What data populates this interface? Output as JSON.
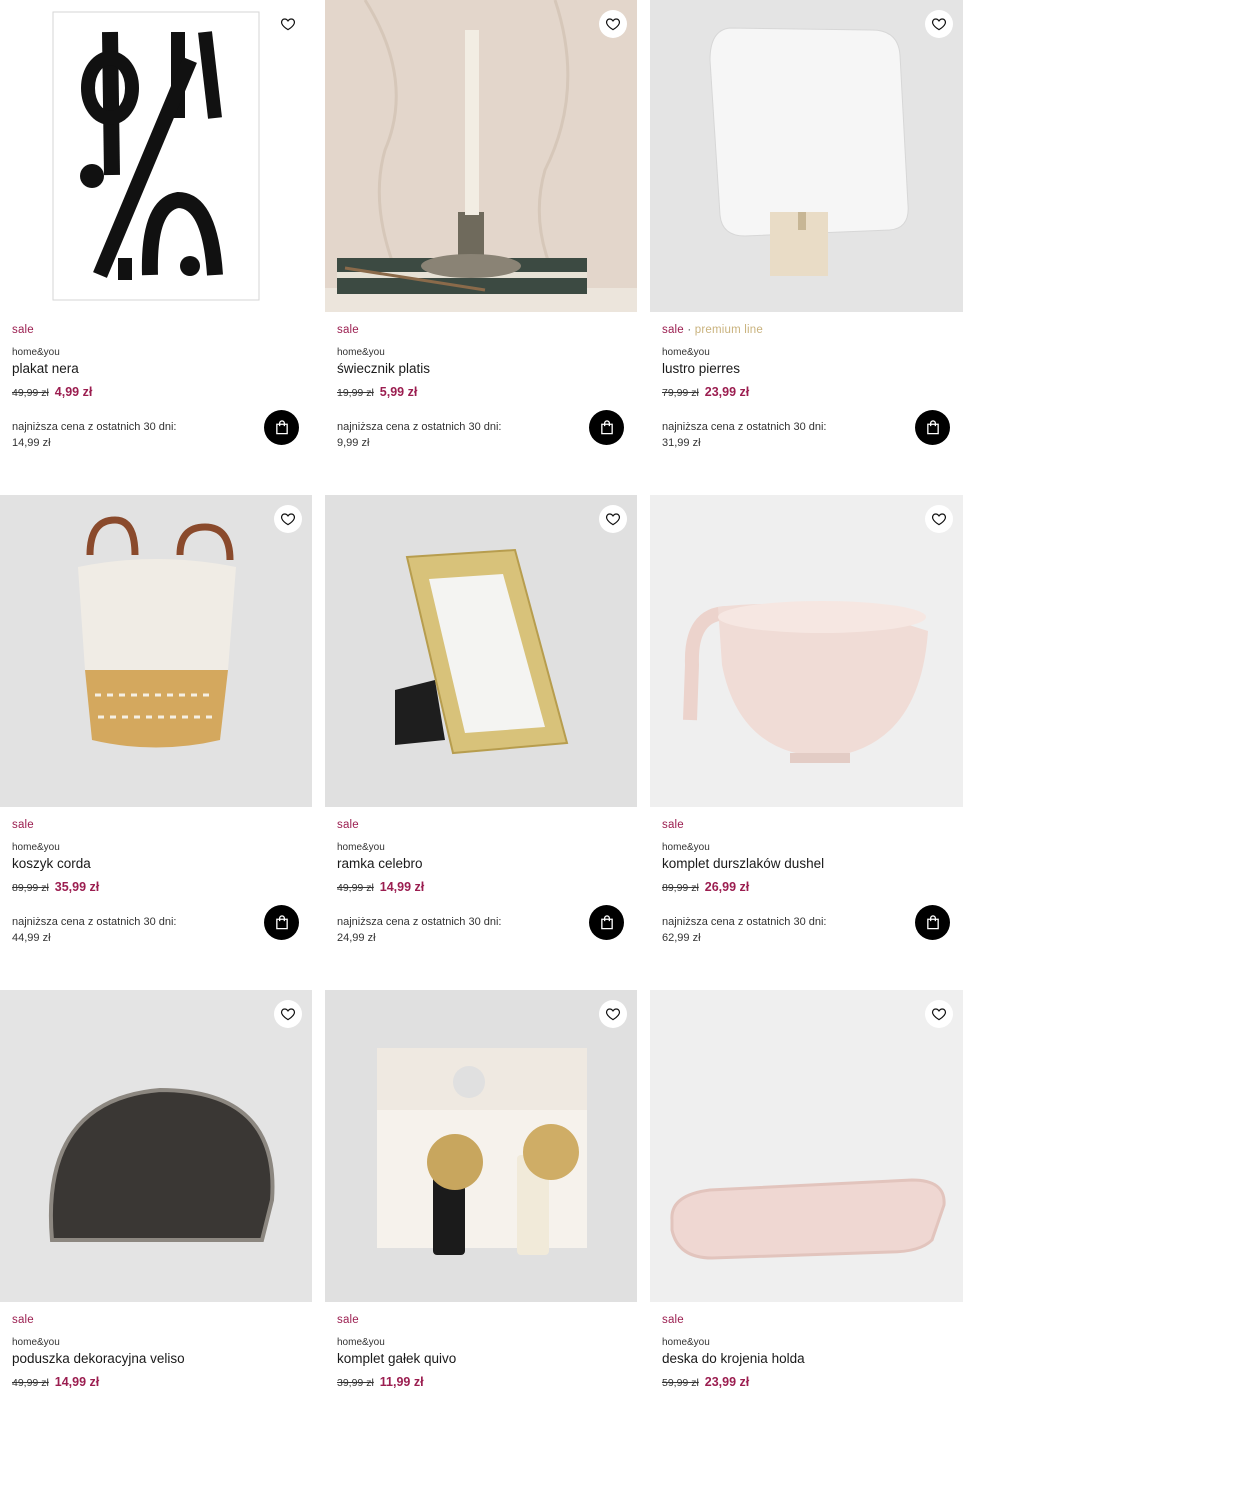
{
  "labels": {
    "sale": "sale",
    "dot": "·",
    "premium": "premium line",
    "lowest_price": "najniższa cena z ostatnich 30 dni:",
    "brand": "home&you"
  },
  "colors": {
    "sale": "#9b1e50",
    "premium": "#c9b27d"
  },
  "products": [
    {
      "name": "plakat nera",
      "old_price": "49,99 zł",
      "new_price": "4,99 zł",
      "lowest": "14,99 zł",
      "premium": false
    },
    {
      "name": "świecznik platis",
      "old_price": "19,99 zł",
      "new_price": "5,99 zł",
      "lowest": "9,99 zł",
      "premium": false
    },
    {
      "name": "lustro pierres",
      "old_price": "79,99 zł",
      "new_price": "23,99 zł",
      "lowest": "31,99 zł",
      "premium": true
    },
    {
      "name": "koszyk corda",
      "old_price": "89,99 zł",
      "new_price": "35,99 zł",
      "lowest": "44,99 zł",
      "premium": false
    },
    {
      "name": "ramka celebro",
      "old_price": "49,99 zł",
      "new_price": "14,99 zł",
      "lowest": "24,99 zł",
      "premium": false
    },
    {
      "name": "komplet durszlaków dushel",
      "old_price": "89,99 zł",
      "new_price": "26,99 zł",
      "lowest": "62,99 zł",
      "premium": false
    },
    {
      "name": "poduszka dekoracyjna veliso",
      "old_price": "49,99 zł",
      "new_price": "14,99 zł",
      "lowest": "",
      "premium": false
    },
    {
      "name": "komplet gałek quivo",
      "old_price": "39,99 zł",
      "new_price": "11,99 zł",
      "lowest": "",
      "premium": false
    },
    {
      "name": "deska do krojenia holda",
      "old_price": "59,99 zł",
      "new_price": "23,99 zł",
      "lowest": "",
      "premium": false
    }
  ]
}
